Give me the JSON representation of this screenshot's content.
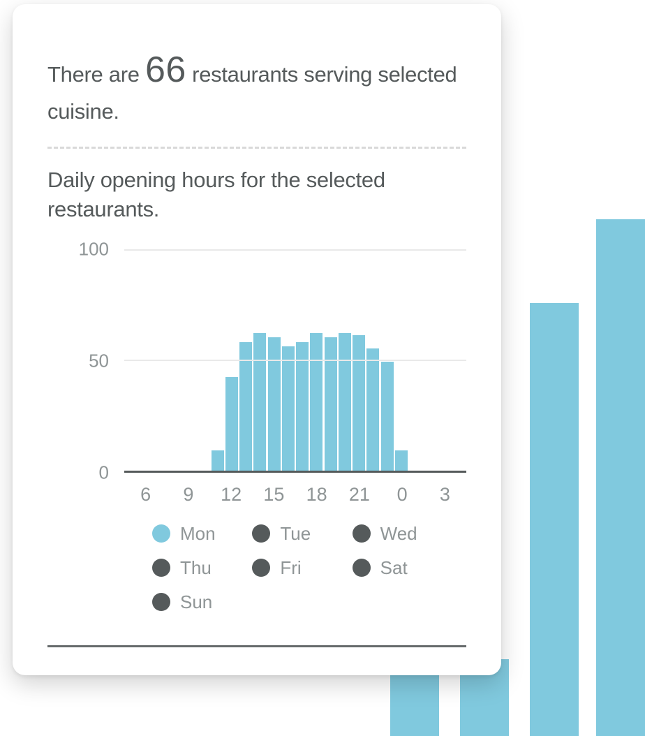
{
  "summary": {
    "prefix": "There are ",
    "count": "66",
    "suffix": " restaurants serving selected cuisine."
  },
  "subtitle": "Daily opening hours for the selected restaurants.",
  "chart_data": {
    "type": "bar",
    "xlabel": "",
    "ylabel": "",
    "ylim": [
      0,
      100
    ],
    "y_ticks": [
      0,
      50,
      100
    ],
    "x_ticks": [
      6,
      9,
      12,
      15,
      18,
      21,
      0,
      3
    ],
    "categories_hours": [
      5,
      6,
      7,
      8,
      9,
      10,
      11,
      12,
      13,
      14,
      15,
      16,
      17,
      18,
      19,
      20,
      21,
      22,
      23,
      0,
      1,
      2,
      3,
      4
    ],
    "series": [
      {
        "name": "Mon",
        "values": [
          0,
          0,
          0,
          0,
          0,
          0,
          9,
          42,
          58,
          62,
          60,
          56,
          58,
          62,
          60,
          62,
          61,
          55,
          49,
          9,
          0,
          0,
          0,
          0
        ]
      },
      {
        "name": "Tue",
        "values": []
      },
      {
        "name": "Wed",
        "values": []
      },
      {
        "name": "Thu",
        "values": []
      },
      {
        "name": "Fri",
        "values": []
      },
      {
        "name": "Sat",
        "values": []
      },
      {
        "name": "Sun",
        "values": []
      }
    ],
    "active_series": "Mon",
    "colors": {
      "active": "#80c9de",
      "inactive": "#555a5b"
    }
  },
  "legend": {
    "items": [
      {
        "label": "Mon",
        "active": true
      },
      {
        "label": "Tue",
        "active": false
      },
      {
        "label": "Wed",
        "active": false
      },
      {
        "label": "Thu",
        "active": false
      },
      {
        "label": "Fri",
        "active": false
      },
      {
        "label": "Sat",
        "active": false
      },
      {
        "label": "Sun",
        "active": false
      }
    ]
  }
}
